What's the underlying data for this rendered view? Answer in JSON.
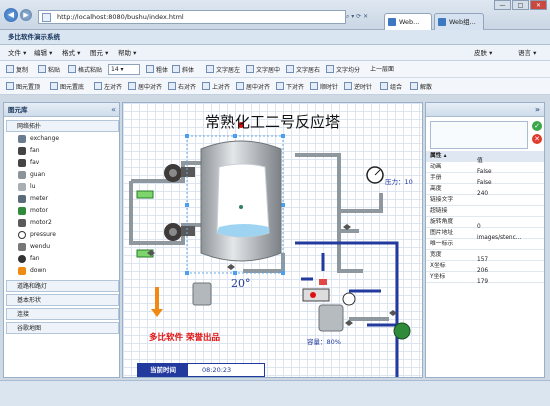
{
  "browser": {
    "url": "http://localhost:8080/bushu/index.html",
    "tabs": [
      "Web...",
      "Web组..."
    ],
    "window_buttons": [
      "—",
      "□",
      "✕"
    ]
  },
  "app": {
    "title": "多比软件演示系统"
  },
  "menubar": {
    "left": [
      "文件 ▾",
      "编辑 ▾",
      "格式 ▾",
      "图元 ▾",
      "帮助 ▾"
    ],
    "right": [
      "皮肤 ▾",
      "语言 ▾"
    ]
  },
  "toolbar1": {
    "items": [
      "复制",
      "粘贴",
      "格式粘贴",
      "粗体",
      "斜体",
      "文字居左",
      "文字居中",
      "文字居右",
      "文字均分",
      "上一层面"
    ],
    "fontsize": "14"
  },
  "toolbar2": {
    "items": [
      "图元置顶",
      "图元置底",
      "左对齐",
      "居中对齐",
      "右对齐",
      "上对齐",
      "居中对齐",
      "下对齐",
      "顺时针",
      "逆时针",
      "组合",
      "解散"
    ]
  },
  "leftpanel": {
    "title": "图元库",
    "groups": [
      "网络拓扑",
      "道路和路灯",
      "基本形状",
      "连接",
      "谷歌地图"
    ],
    "items": [
      "exchange",
      "fan",
      "fav",
      "guan",
      "lu",
      "meter",
      "motor",
      "motor2",
      "pressure",
      "wendu",
      "fan",
      "down"
    ]
  },
  "canvas": {
    "title": "常熟化工二号反应塔",
    "temperature": "20°",
    "pressure_label": "压力：10",
    "capacity_label": "容量：80%",
    "brand": "多比软件 荣誉出品",
    "time_label": "当前时间",
    "time_value": "08:20:23"
  },
  "properties": {
    "headers": [
      "属性 ▴",
      "值"
    ],
    "rows": [
      {
        "k": "动画",
        "v": "False"
      },
      {
        "k": "手册",
        "v": "False"
      },
      {
        "k": "高度",
        "v": "240"
      },
      {
        "k": "链接文字",
        "v": ""
      },
      {
        "k": "超链接",
        "v": ""
      },
      {
        "k": "旋转角度",
        "v": "0"
      },
      {
        "k": "图片地址",
        "v": "images/stenc..."
      },
      {
        "k": "唯一标示",
        "v": ""
      },
      {
        "k": "宽度",
        "v": "157"
      },
      {
        "k": "X坐标",
        "v": "206"
      },
      {
        "k": "Y坐标",
        "v": "179"
      }
    ]
  },
  "colors": {
    "pipe": "#8f979f",
    "blue_pipe": "#223a9e",
    "tank_silver": "#bfc4c8",
    "brand_red": "#e01010"
  }
}
